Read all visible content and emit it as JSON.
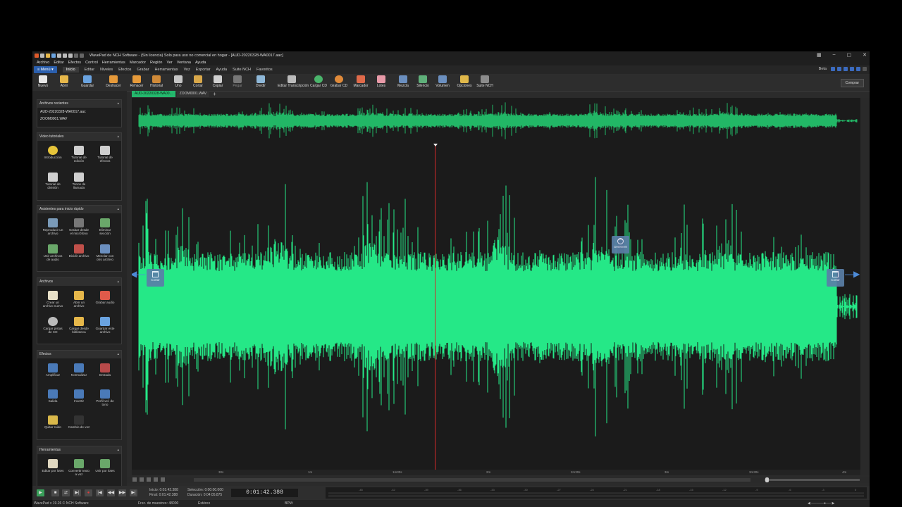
{
  "window": {
    "title": "WavePad de NCH Software - (Sin licencia) Solo para uso no comercial en hogar - [AUD-20220328-WA0017.aac]"
  },
  "menubar": [
    "Archivo",
    "Editar",
    "Efectos",
    "Control",
    "Herramientas",
    "Marcador",
    "Región",
    "Ver",
    "Ventana",
    "Ayuda"
  ],
  "ribbon": {
    "menu_label": "Menú",
    "tabs": [
      "Inicio",
      "Editar",
      "Niveles",
      "Efectos",
      "Grabar",
      "Herramientas",
      "Voz",
      "Exportar",
      "Ayuda",
      "Suite NCH",
      "Favoritos"
    ],
    "active_tab": "Inicio",
    "beta_label": "Beta"
  },
  "toolbar": {
    "buttons": [
      "Nuevo",
      "Abrir",
      "Guardar",
      "Deshacer",
      "Rehacer",
      "Historial",
      "Uno",
      "Cortar",
      "Copiar",
      "Pegar",
      "Dividir",
      "Editar Transcripción",
      "Cargar CD",
      "Grabar CD",
      "Marcador",
      "Lotes",
      "Mezcla",
      "Silencio",
      "Volumen",
      "Opciones",
      "Suite NCH"
    ],
    "buy_label": "Comprar"
  },
  "sidebar": {
    "recent": {
      "title": "Archivos recientes",
      "files": [
        "AUD-20220328-WA0017.aac",
        "ZOOM0001.WAV"
      ]
    },
    "tutorials": {
      "title": "Video tutoriales",
      "items": [
        "Introducción",
        "Tutorial de edición",
        "Tutorial de efectos",
        "Tutorial de división",
        "Tonos de llamada"
      ]
    },
    "quickstart": {
      "title": "Asistentes para inicio rápido",
      "items": [
        "Reproducir un archivo",
        "Grabar desde el micrófono",
        "Eliminar sección",
        "Unir archivos de audio",
        "Dividir archivo",
        "Mezclar con otro archivo"
      ]
    },
    "files": {
      "title": "Archivos",
      "items": [
        "Crear un archivo nuevo",
        "Abrir un archivo",
        "Grabar audio",
        "Cargar pistas de CD",
        "Cargar desde biblioteca",
        "Guardar este archivo"
      ]
    },
    "effects": {
      "title": "Efectos",
      "items": [
        "Amplificar",
        "Normalizar",
        "Entrada",
        "Salida",
        "Invertir",
        "Perfil vel. de tono",
        "Quitar ruido",
        "Cambio de voz"
      ]
    },
    "tools": {
      "title": "Herramientas",
      "items": [
        "Editar por lotes",
        "Convertir texto a voz",
        "Unir por lotes"
      ]
    }
  },
  "file_tabs": [
    "AUD-20220328-WA00...",
    "ZOOM0001.WAV"
  ],
  "markers": {
    "left_cut": "Cortar",
    "right_cut": "Cortar",
    "reverb": "Derever8"
  },
  "timeline": [
    "30s",
    "1m",
    "1m30s",
    "2m",
    "2m30s",
    "3m",
    "3m30s",
    "4m"
  ],
  "transport": {
    "inicio_label": "Inicio:",
    "inicio_value": "0:01:42.388",
    "final_label": "Final:",
    "final_value": "0:01:42.388",
    "seleccion_label": "Selección:",
    "seleccion_value": "0:00:00.000",
    "duracion_label": "Duración:",
    "duracion_value": "0:04:05.875",
    "current_time": "0:01:42.388"
  },
  "meter_labels": [
    "-45",
    "-42",
    "-39",
    "-36",
    "-33",
    "-30",
    "-27",
    "-24",
    "-21",
    "-18",
    "-15",
    "-12",
    "-9",
    "-6",
    "-3",
    "0"
  ],
  "status": {
    "version": "WavePad v 19.26 © NCH Software",
    "sample_rate": "Frec. de muestreo: 48000",
    "channels": "Estéreo",
    "bpm": "BPM:"
  },
  "colors": {
    "waveform": "#25e887",
    "overview_waveform": "#22b766",
    "accent": "#2b5fad",
    "playhead": "#d02a2a",
    "marker": "#5a7fa8"
  }
}
